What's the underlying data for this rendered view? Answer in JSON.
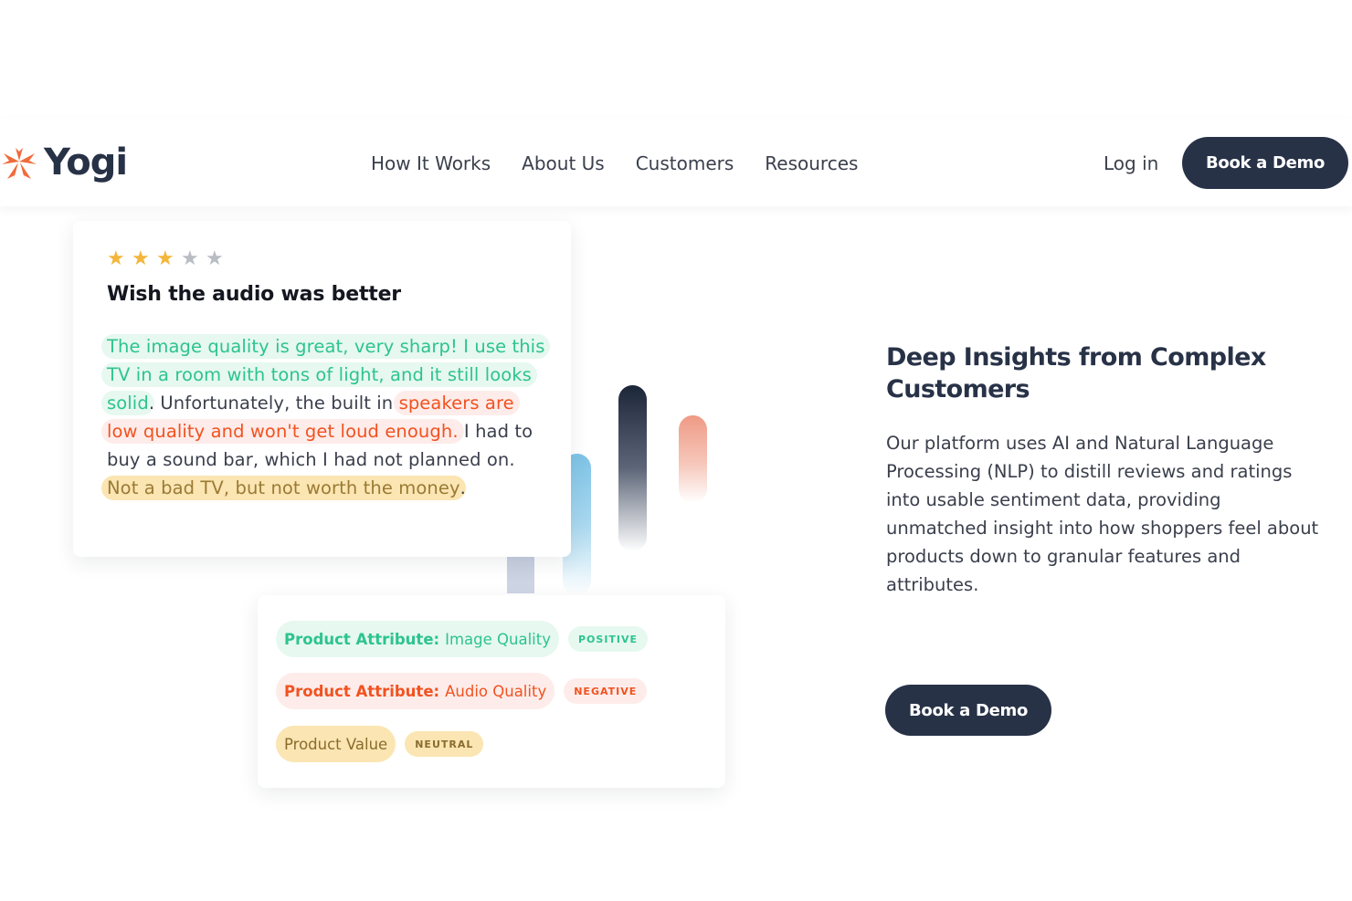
{
  "brand": {
    "name": "Yogi",
    "logo_color": "#f06b3a",
    "text_color": "#283247"
  },
  "nav": {
    "items": [
      {
        "label": "How It Works"
      },
      {
        "label": "About Us"
      },
      {
        "label": "Customers"
      },
      {
        "label": "Resources"
      }
    ],
    "login_label": "Log in",
    "cta_label": "Book a Demo"
  },
  "review": {
    "rating": 3,
    "max_rating": 5,
    "title": "Wish the audio was better",
    "segments": [
      {
        "text": "The image quality is great, very sharp! I use this TV in a room with tons of light, and it still looks solid",
        "sentiment": "positive"
      },
      {
        "text": ". Unfortunately, the built in ",
        "sentiment": "none"
      },
      {
        "text": "speakers are low quality and won't get loud enough.",
        "sentiment": "negative"
      },
      {
        "text": " I had to buy a sound bar, which I had not planned on. ",
        "sentiment": "none"
      },
      {
        "text": "Not a bad TV, but not worth the money",
        "sentiment": "neutral"
      },
      {
        "text": ".",
        "sentiment": "none"
      }
    ]
  },
  "attributes": [
    {
      "label": "Product Attribute:",
      "value": "Image Quality",
      "tag": "POSITIVE",
      "sentiment": "positive"
    },
    {
      "label": "Product Attribute:",
      "value": "Audio Quality",
      "tag": "NEGATIVE",
      "sentiment": "negative"
    },
    {
      "label": "",
      "value": "Product Value",
      "tag": "NEUTRAL",
      "sentiment": "neutral"
    }
  ],
  "content": {
    "headline": "Deep Insights from Complex Customers",
    "description": "Our platform uses AI and Natural Language Processing (NLP) to distill reviews and ratings into usable sentiment data, providing unmatched insight into how shoppers feel about products down to granular features and attributes.",
    "cta_label": "Book a Demo"
  },
  "colors": {
    "positive": "#2dc48d",
    "negative": "#f2521f",
    "neutral": "#9a7a34",
    "dark": "#283247",
    "star": "#f4b63a"
  }
}
